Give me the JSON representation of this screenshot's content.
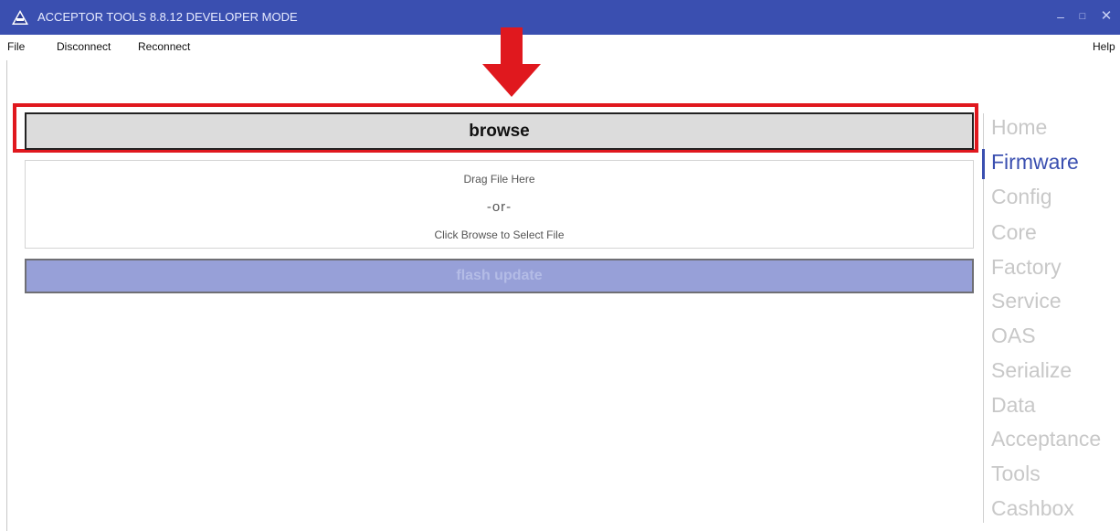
{
  "window": {
    "title": "ACCEPTOR TOOLS 8.8.12 DEVELOPER MODE",
    "controls": {
      "minimize": "–",
      "maximize": "□",
      "close": "✕"
    },
    "accent_color": "#3a4fb0"
  },
  "menu": {
    "file": "File",
    "disconnect": "Disconnect",
    "reconnect": "Reconnect",
    "help": "Help"
  },
  "firmware": {
    "browse_label": "browse",
    "dropzone": {
      "line1": "Drag File Here",
      "or": "-or-",
      "line2": "Click Browse to Select File"
    },
    "flash_label": "flash update"
  },
  "annotation": {
    "arrow_color": "#e0181e",
    "highlight_color": "#e0181e"
  },
  "nav": {
    "active": "Firmware",
    "items": [
      "Home",
      "Firmware",
      "Config",
      "Core",
      "Factory",
      "Service",
      "OAS",
      "Serialize",
      "Data",
      "Acceptance",
      "Tools",
      "Cashbox"
    ]
  }
}
